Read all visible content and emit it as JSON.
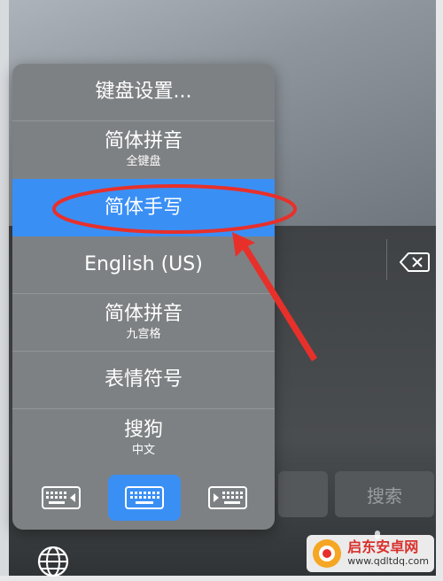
{
  "menu": {
    "items": [
      {
        "label": "键盘设置...",
        "sub": ""
      },
      {
        "label": "简体拼音",
        "sub": "全键盘"
      },
      {
        "label": "简体手写",
        "sub": ""
      },
      {
        "label": "English (US)",
        "sub": ""
      },
      {
        "label": "简体拼音",
        "sub": "九宫格"
      },
      {
        "label": "表情符号",
        "sub": ""
      },
      {
        "label": "搜狗",
        "sub": "中文"
      }
    ],
    "selected_index": 2,
    "bottom_buttons": [
      {
        "icon": "keyboard-left-icon",
        "active": false
      },
      {
        "icon": "keyboard-full-icon",
        "active": true
      },
      {
        "icon": "keyboard-right-icon",
        "active": false
      }
    ]
  },
  "keyboard": {
    "search_key": "搜索",
    "delete_icon": "delete-icon",
    "globe_icon": "globe-icon"
  },
  "watermark": {
    "title": "启东安卓网",
    "url": "www.qdltdq.com"
  },
  "colors": {
    "accent": "#3a8ff5",
    "annotation": "#e8302b",
    "menu_bg": "#7e8184"
  }
}
